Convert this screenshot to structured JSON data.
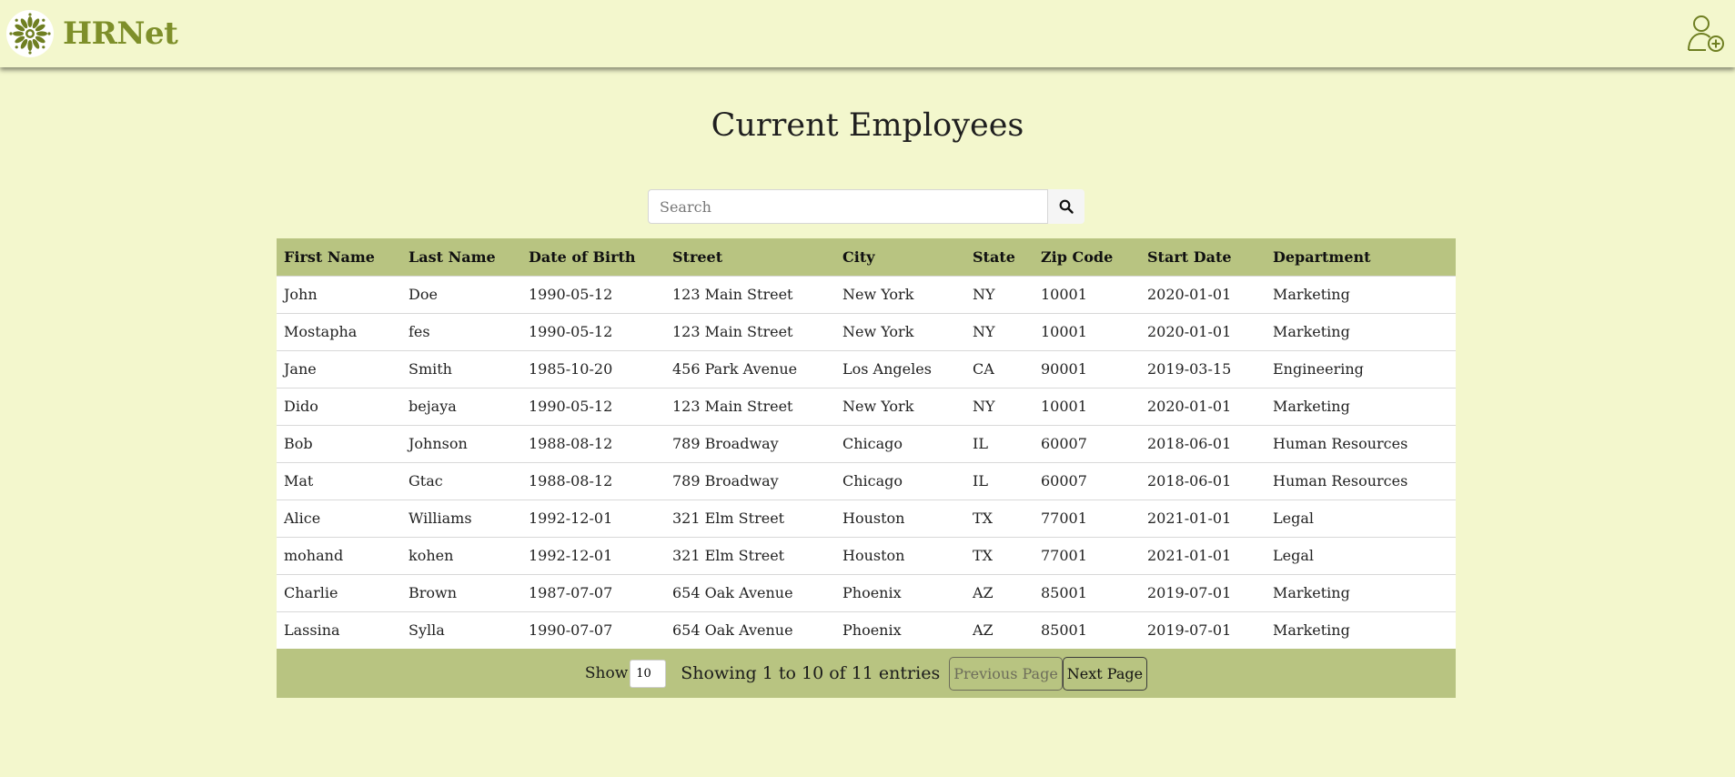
{
  "header": {
    "brand": "HRNet",
    "logo_icon": "flower-logo-icon",
    "add_employee_icon": "add-user-icon"
  },
  "main": {
    "title": "Current Employees",
    "search": {
      "placeholder": "Search",
      "value": "",
      "icon": "search-icon"
    }
  },
  "table": {
    "columns": [
      "First Name",
      "Last Name",
      "Date of Birth",
      "Street",
      "City",
      "State",
      "Zip Code",
      "Start Date",
      "Department"
    ],
    "rows": [
      [
        "John",
        "Doe",
        "1990-05-12",
        "123 Main Street",
        "New York",
        "NY",
        "10001",
        "2020-01-01",
        "Marketing"
      ],
      [
        "Mostapha",
        "fes",
        "1990-05-12",
        "123 Main Street",
        "New York",
        "NY",
        "10001",
        "2020-01-01",
        "Marketing"
      ],
      [
        "Jane",
        "Smith",
        "1985-10-20",
        "456 Park Avenue",
        "Los Angeles",
        "CA",
        "90001",
        "2019-03-15",
        "Engineering"
      ],
      [
        "Dido",
        "bejaya",
        "1990-05-12",
        "123 Main Street",
        "New York",
        "NY",
        "10001",
        "2020-01-01",
        "Marketing"
      ],
      [
        "Bob",
        "Johnson",
        "1988-08-12",
        "789 Broadway",
        "Chicago",
        "IL",
        "60007",
        "2018-06-01",
        "Human Resources"
      ],
      [
        "Mat",
        "Gtac",
        "1988-08-12",
        "789 Broadway",
        "Chicago",
        "IL",
        "60007",
        "2018-06-01",
        "Human Resources"
      ],
      [
        "Alice",
        "Williams",
        "1992-12-01",
        "321 Elm Street",
        "Houston",
        "TX",
        "77001",
        "2021-01-01",
        "Legal"
      ],
      [
        "mohand",
        "kohen",
        "1992-12-01",
        "321 Elm Street",
        "Houston",
        "TX",
        "77001",
        "2021-01-01",
        "Legal"
      ],
      [
        "Charlie",
        "Brown",
        "1987-07-07",
        "654 Oak Avenue",
        "Phoenix",
        "AZ",
        "85001",
        "2019-07-01",
        "Marketing"
      ],
      [
        "Lassina",
        "Sylla",
        "1990-07-07",
        "654 Oak Avenue",
        "Phoenix",
        "AZ",
        "85001",
        "2019-07-01",
        "Marketing"
      ]
    ]
  },
  "pagination": {
    "show_label": "Show",
    "page_size": "10",
    "entries_text": "Showing 1 to 10 of 11 entries",
    "prev_label": "Previous Page",
    "next_label": "Next Page"
  },
  "colors": {
    "background": "#f3f7cd",
    "accent": "#b8c481",
    "brand": "#7e8f2a"
  }
}
